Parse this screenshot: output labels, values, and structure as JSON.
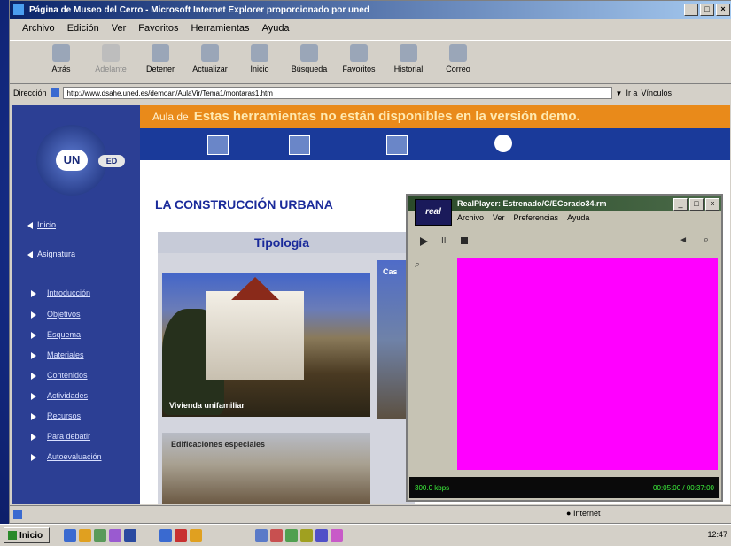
{
  "browser": {
    "title": "Página de Museo del Cerro - Microsoft Internet Explorer proporcionado por uned",
    "menu": [
      "Archivo",
      "Edición",
      "Ver",
      "Favoritos",
      "Herramientas",
      "Ayuda"
    ],
    "toolbar": [
      "Atrás",
      "Adelante",
      "Detener",
      "Actualizar",
      "Inicio",
      "Búsqueda",
      "Favoritos",
      "Historial",
      "Correo"
    ],
    "address_label": "Dirección",
    "address_value": "http://www.dsahe.uned.es/demoan/AulaVir/Tema1/montaras1.htm",
    "go_label": "Ir a",
    "links_label": "Vínculos",
    "status_zone": "Internet"
  },
  "site": {
    "logo_text": "UN",
    "logo_ed": "ED",
    "banner_prefix": "Aula de",
    "banner": "Estas herramientas no están disponibles en la versión demo.",
    "nav_links": [
      "Inicio",
      "Asignatura"
    ],
    "nav_items": [
      "Introducción",
      "Objetivos",
      "Esquema",
      "Materiales",
      "Contenidos",
      "Actividades",
      "Recursos",
      "Para debatir",
      "Autoevaluación"
    ],
    "page_title": "LA CONSTRUCCIÓN URBANA",
    "section_title": "Tipología",
    "photo1_caption": "Vivienda unifamiliar",
    "photo2_caption": "Cas",
    "photo3_caption": "Edificaciones especiales"
  },
  "realplayer": {
    "logo": "real",
    "title": "RealPlayer: Estrenado/C/ECorado34.rm",
    "menu": [
      "Archivo",
      "Ver",
      "Preferencias",
      "Ayuda"
    ],
    "status_left": "300.0 kbps",
    "status_right": "00:05:00 / 00:37:00",
    "video_color": "#ff00ff"
  },
  "taskbar": {
    "start_label": "Inicio",
    "clock": "12:47"
  }
}
